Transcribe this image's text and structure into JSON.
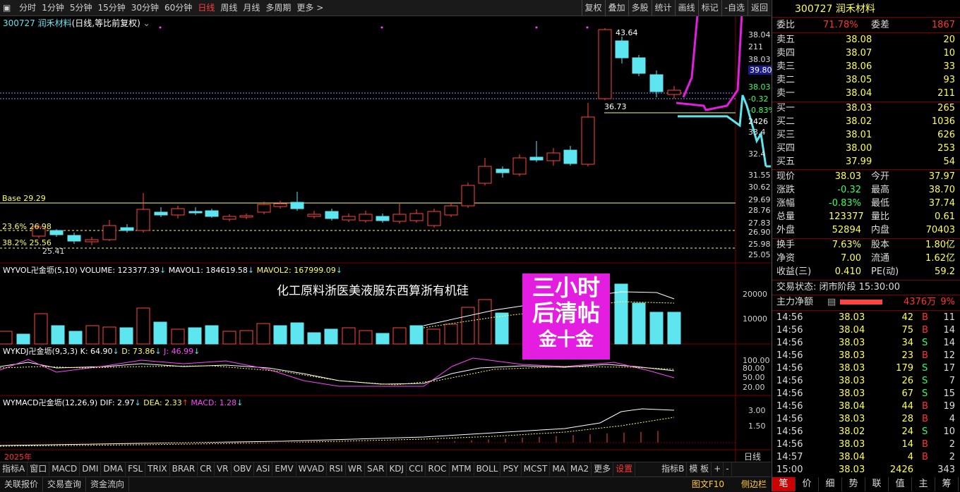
{
  "toolbar": {
    "periods": [
      "分时",
      "1分钟",
      "5分钟",
      "15分钟",
      "30分钟",
      "60分钟",
      "日线",
      "周线",
      "月线",
      "多周期",
      "更多 >"
    ],
    "active_period": "日线",
    "right_buttons": [
      "复权",
      "叠加",
      "多股",
      "统计",
      "画线",
      "标记",
      "-自选",
      "返回"
    ]
  },
  "stock_title": {
    "code_name": "300727 润禾材料",
    "suffix": "(日线,等比前复权)"
  },
  "price_axis": [
    "38.04",
    "211",
    "38.03",
    "39.80",
    "38.03",
    "-0.32",
    "-0.83%",
    "2426",
    "33.4",
    "32.4",
    "31.55",
    "30.62",
    "29.69",
    "28.76",
    "27.83",
    "26.90",
    "25.98",
    "25.05"
  ],
  "chart_labels": {
    "high": "43.64",
    "low_mark": "36.73",
    "base": "Base 29.29",
    "fib1": "23.6% 26.98",
    "fib2": "38.2% 25.56",
    "low": "25.41",
    "year": "2025年"
  },
  "volume_indicator": {
    "name": "WYVOL卍金坜(5,10)",
    "v1": "VOLUME: 123377.39",
    "v2": "MAVOL1: 184619.58",
    "v3": "MAVOL2: 167999.09",
    "axis": [
      "20000",
      "10000"
    ]
  },
  "kdj_indicator": {
    "name": "WYKDJ卍金坜(9,3,3)",
    "k": "K: 64.90",
    "d": "D: 73.86",
    "j": "J: 46.99",
    "axis": [
      "100.00",
      "80.00",
      "50.00",
      "20.00"
    ]
  },
  "macd_indicator": {
    "name": "WYMACD卍金坜(12,26,9)",
    "dif": "DIF: 2.97",
    "dea": "DEA: 2.33",
    "macd": "MACD: 1.28",
    "axis": [
      "3.00",
      "1.50"
    ]
  },
  "headline": "化工原料浙医美液服东西算浙有机硅",
  "promo": {
    "line1": "三小时",
    "line2": "后清帖",
    "line3": "金十金"
  },
  "bottom_tabs": [
    "指标A",
    "窗口",
    "MACD",
    "DMI",
    "DMA",
    "FSL",
    "TRIX",
    "BRAR",
    "CR",
    "VR",
    "OBV",
    "ASI",
    "EMV",
    "WVAD",
    "RSI",
    "WR",
    "SAR",
    "KDJ",
    "CCI",
    "ROC",
    "MTM",
    "BOLL",
    "PSY",
    "MCST",
    "MA",
    "MA2",
    "更多",
    "设置",
    "指标B",
    "模 板",
    "+",
    "-"
  ],
  "right_axis_bottom": "日线",
  "statusbar": {
    "left": [
      "关联报价",
      "交易查询",
      "资金流向"
    ],
    "right": [
      "图文F10",
      "侧边栏"
    ]
  },
  "panel": {
    "title": "300727 润禾材料",
    "weibi": {
      "label": "委比",
      "value": "71.78%",
      "label2": "委差",
      "value2": "1867"
    },
    "asks": [
      {
        "label": "卖五",
        "price": "38.08",
        "vol": "20"
      },
      {
        "label": "卖四",
        "price": "38.07",
        "vol": "10"
      },
      {
        "label": "卖三",
        "price": "38.06",
        "vol": "33"
      },
      {
        "label": "卖二",
        "price": "38.05",
        "vol": "93"
      },
      {
        "label": "卖一",
        "price": "38.04",
        "vol": "211"
      }
    ],
    "bids": [
      {
        "label": "买一",
        "price": "38.03",
        "vol": "265"
      },
      {
        "label": "买二",
        "price": "38.02",
        "vol": "1036"
      },
      {
        "label": "买三",
        "price": "38.01",
        "vol": "626"
      },
      {
        "label": "买四",
        "price": "38.00",
        "vol": "253"
      },
      {
        "label": "买五",
        "price": "37.99",
        "vol": "54"
      }
    ],
    "quote": [
      {
        "l1": "现价",
        "v1": "38.03",
        "l2": "今开",
        "v2": "37.97"
      },
      {
        "l1": "涨跌",
        "v1": "-0.32",
        "l2": "最高",
        "v2": "38.70"
      },
      {
        "l1": "涨幅",
        "v1": "-0.83%",
        "l2": "最低",
        "v2": "37.74"
      },
      {
        "l1": "总量",
        "v1": "123377",
        "l2": "量比",
        "v2": "0.61"
      },
      {
        "l1": "外盘",
        "v1": "52894",
        "l2": "内盘",
        "v2": "70403"
      }
    ],
    "stats": [
      {
        "l1": "换手",
        "v1": "7.63%",
        "l2": "股本",
        "v2": "1.80亿"
      },
      {
        "l1": "净资",
        "v1": "7.00",
        "l2": "流通",
        "v2": "1.62亿"
      },
      {
        "l1": "收益(三)",
        "v1": "0.410",
        "l2": "PE(动)",
        "v2": "59.2"
      }
    ],
    "trade_status": "交易状态: 闭市阶段 15:30:00",
    "main_flow": {
      "label": "主力净额",
      "value": "4376万",
      "pct": "9%"
    },
    "ticks": [
      {
        "t": "14:56",
        "p": "38.03",
        "v": "42",
        "s": "B",
        "n": "11"
      },
      {
        "t": "14:56",
        "p": "38.04",
        "v": "75",
        "s": "B",
        "n": "14"
      },
      {
        "t": "14:56",
        "p": "38.03",
        "v": "34",
        "s": "S",
        "n": "14"
      },
      {
        "t": "14:56",
        "p": "38.03",
        "v": "23",
        "s": "B",
        "n": "12"
      },
      {
        "t": "14:56",
        "p": "38.03",
        "v": "179",
        "s": "S",
        "n": "17"
      },
      {
        "t": "14:56",
        "p": "38.03",
        "v": "26",
        "s": "S",
        "n": "7"
      },
      {
        "t": "14:56",
        "p": "38.03",
        "v": "67",
        "s": "S",
        "n": "15"
      },
      {
        "t": "14:56",
        "p": "38.04",
        "v": "44",
        "s": "B",
        "n": "19"
      },
      {
        "t": "14:56",
        "p": "38.03",
        "v": "28",
        "s": "B",
        "n": "4"
      },
      {
        "t": "14:56",
        "p": "38.02",
        "v": "24",
        "s": "S",
        "n": "10"
      },
      {
        "t": "14:56",
        "p": "38.03",
        "v": "14",
        "s": "B",
        "n": "2"
      },
      {
        "t": "14:57",
        "p": "38.04",
        "v": "4",
        "s": "B",
        "n": "2"
      },
      {
        "t": "15:00",
        "p": "38.03",
        "v": "2426",
        "s": "",
        "n": "343"
      }
    ],
    "side_tabs": [
      "笔",
      "价",
      "细",
      "势",
      "联",
      "值",
      "主",
      "筹"
    ]
  }
}
